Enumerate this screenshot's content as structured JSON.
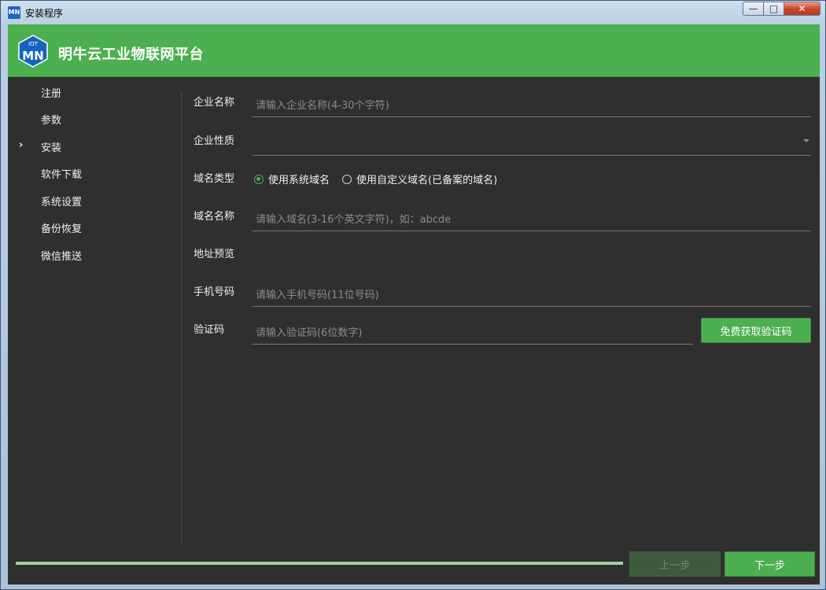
{
  "window": {
    "title": "安装程序",
    "icon_text": "MN",
    "controls": {
      "minimize": "—",
      "maximize": "□",
      "close": "✕"
    }
  },
  "header": {
    "app_title": "明牛云工业物联网平台",
    "logo_text": "MN",
    "logo_subtext": "IOT",
    "brand_color": "#4caf50"
  },
  "sidebar": {
    "items": [
      {
        "label": "注册",
        "active": false
      },
      {
        "label": "参数",
        "active": false
      },
      {
        "label": "安装",
        "active": true
      },
      {
        "label": "软件下载",
        "active": false
      },
      {
        "label": "系统设置",
        "active": false
      },
      {
        "label": "备份恢复",
        "active": false
      },
      {
        "label": "微信推送",
        "active": false
      }
    ],
    "active_marker": "›"
  },
  "form": {
    "company_name": {
      "label": "企业名称",
      "value": "",
      "placeholder": "请输入企业名称(4-30个字符)"
    },
    "company_type": {
      "label": "企业性质",
      "value": ""
    },
    "domain_type": {
      "label": "域名类型",
      "options": [
        {
          "label": "使用系统域名",
          "selected": true
        },
        {
          "label": "使用自定义域名(已备案的域名)",
          "selected": false
        }
      ]
    },
    "domain_name": {
      "label": "域名名称",
      "value": "",
      "placeholder": "请输入域名(3-16个英文字符)，如：abcde"
    },
    "address_preview": {
      "label": "地址预览",
      "value": ""
    },
    "phone": {
      "label": "手机号码",
      "value": "",
      "placeholder": "请输入手机号码(11位号码)"
    },
    "verify_code": {
      "label": "验证码",
      "value": "",
      "placeholder": "请输入验证码(6位数字)",
      "button": "免费获取验证码"
    }
  },
  "footer": {
    "progress": 1.0,
    "prev_label": "上一步",
    "next_label": "下一步"
  }
}
